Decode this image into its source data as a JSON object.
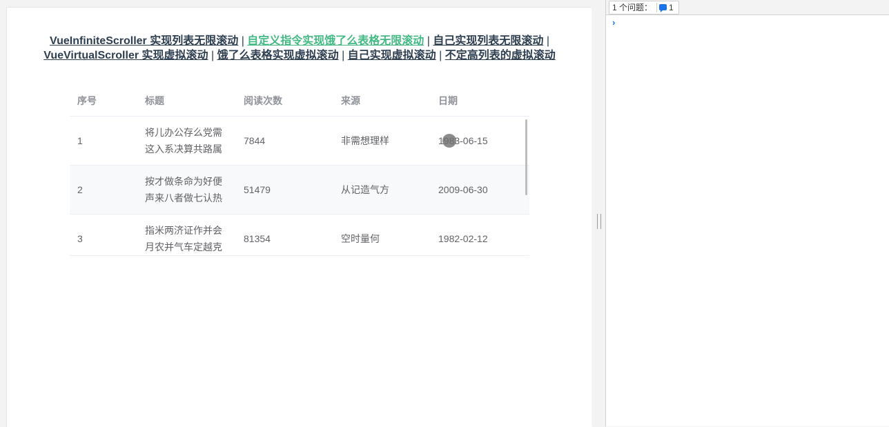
{
  "nav": {
    "links": [
      "VueInfiniteScroller 实现列表无限滚动",
      "自定义指令实现饿了么表格无限滚动",
      "自己实现列表无限滚动",
      "VueVirtualScroller 实现虚拟滚动",
      "饿了么表格实现虚拟滚动",
      "自己实现虚拟滚动",
      "不定高列表的虚拟滚动"
    ],
    "separator": "|",
    "active_index": 1,
    "active_color": "#42b983"
  },
  "table": {
    "columns": [
      "序号",
      "标题",
      "阅读次数",
      "来源",
      "日期"
    ],
    "rows": [
      {
        "index": "1",
        "title_line1": "将儿办公存么党需",
        "title_line2": "这入系决算共路属",
        "reads": "7844",
        "source": "非需想理样",
        "date": "1983-06-15"
      },
      {
        "index": "2",
        "title_line1": "按才做条命为好便",
        "title_line2": "声来八者做七认热",
        "reads": "51479",
        "source": "从记造气方",
        "date": "2009-06-30"
      },
      {
        "index": "3",
        "title_line1": "指米两济证作并会",
        "title_line2": "月农并气车定越克",
        "reads": "81354",
        "source": "空时量何",
        "date": "1982-02-12"
      }
    ]
  },
  "devtools": {
    "issues_label": "1 个问题：",
    "issues_count": "1",
    "prompt_symbol": "›"
  }
}
